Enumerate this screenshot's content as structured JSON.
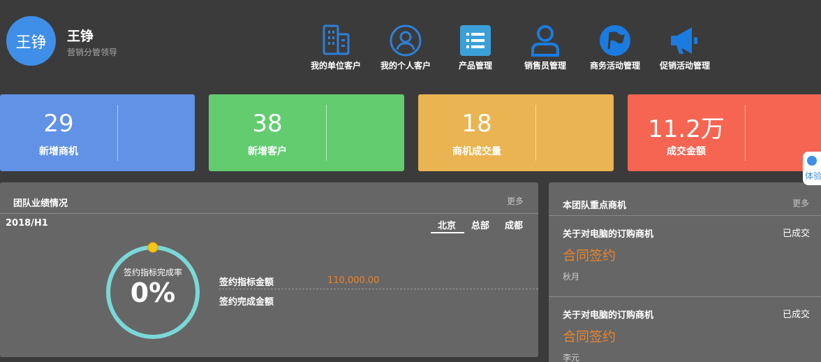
{
  "user": {
    "avatar_text": "王铮",
    "name": "王铮",
    "role": "营销分管领导"
  },
  "nav": [
    {
      "label": "我的单位客户",
      "icon": "building-icon"
    },
    {
      "label": "我的个人客户",
      "icon": "person-circle-icon"
    },
    {
      "label": "产品管理",
      "icon": "list-icon"
    },
    {
      "label": "销售员管理",
      "icon": "user-icon"
    },
    {
      "label": "商务活动管理",
      "icon": "flag-icon"
    },
    {
      "label": "促销活动管理",
      "icon": "megaphone-icon"
    }
  ],
  "stats": [
    {
      "value": "29",
      "label": "新增商机",
      "color": "#6192e5"
    },
    {
      "value": "38",
      "label": "新增客户",
      "color": "#62cc6f"
    },
    {
      "value": "18",
      "label": "商机成交量",
      "color": "#e9b451"
    },
    {
      "value": "11.2万",
      "label": "成交金额",
      "color": "#f56552"
    }
  ],
  "team_panel": {
    "title": "团队业绩情况",
    "more": "更多",
    "period": "2018/H1",
    "tabs": [
      "北京",
      "总部",
      "成都"
    ],
    "active_tab": "北京",
    "gauge": {
      "label": "签约指标完成率",
      "percent": "0%",
      "value": 0,
      "ring_color": "#7ad8d8",
      "knob_color": "#f5c518"
    },
    "metrics": [
      {
        "label": "签约指标金额",
        "value": "110,000.00"
      },
      {
        "label": "签约完成金额",
        "value": ""
      }
    ]
  },
  "opps_panel": {
    "title": "本团队重点商机",
    "more": "更多",
    "items": [
      {
        "title": "关于对电脑的订购商机",
        "status": "已成交",
        "stage": "合同签约",
        "owner": "秋月"
      },
      {
        "title": "关于对电脑的订购商机",
        "status": "已成交",
        "stage": "合同签约",
        "owner": "李元"
      }
    ]
  },
  "float_button": {
    "label": "体验"
  },
  "colors": {
    "accent": "#3f8fe8",
    "orange": "#e8852e",
    "bg": "#3b3b3b",
    "panel": "#666666"
  }
}
